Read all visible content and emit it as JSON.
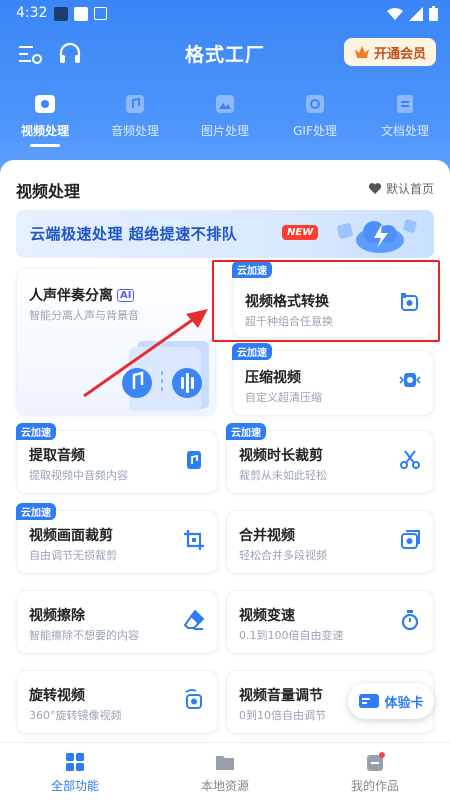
{
  "status": {
    "time": "4:32"
  },
  "header": {
    "title": "格式工厂",
    "vip_label": "开通会员"
  },
  "tabs": [
    {
      "label": "视频处理",
      "icon": "video-icon",
      "active": true
    },
    {
      "label": "音频处理",
      "icon": "audio-icon"
    },
    {
      "label": "图片处理",
      "icon": "image-icon"
    },
    {
      "label": "GIF处理",
      "icon": "gif-icon"
    },
    {
      "label": "文档处理",
      "icon": "document-icon"
    }
  ],
  "section": {
    "title": "视频处理",
    "default_home": "默认首页"
  },
  "banner": {
    "text": "云端极速处理 超绝提速不排队",
    "badge": "NEW"
  },
  "featured": {
    "title": "人声伴奏分离",
    "ai_badge": "AI",
    "subtitle": "智能分离人声与背景音"
  },
  "cloud_badge": "云加速",
  "tools": [
    {
      "title": "视频格式转换",
      "subtitle": "超千种组合任意换",
      "cloud": true
    },
    {
      "title": "压缩视频",
      "subtitle": "自定义超清压缩",
      "cloud": true
    },
    {
      "title": "提取音频",
      "subtitle": "提取视频中音频内容",
      "cloud": true
    },
    {
      "title": "视频时长裁剪",
      "subtitle": "裁剪从未如此轻松",
      "cloud": true
    },
    {
      "title": "视频画面裁剪",
      "subtitle": "自由调节无损裁剪",
      "cloud": true
    },
    {
      "title": "合并视频",
      "subtitle": "轻松合并多段视频",
      "cloud": false
    },
    {
      "title": "视频擦除",
      "subtitle": "智能擦除不想要的内容",
      "cloud": false
    },
    {
      "title": "视频变速",
      "subtitle": "0.1到100倍自由变速",
      "cloud": false
    },
    {
      "title": "旋转视频",
      "subtitle": "360°旋转镜像视频",
      "cloud": false
    },
    {
      "title": "视频音量调节",
      "subtitle": "0到10倍自由调节",
      "cloud": false
    }
  ],
  "trial_card": "体验卡",
  "nav": [
    {
      "label": "全部功能",
      "active": true
    },
    {
      "label": "本地资源"
    },
    {
      "label": "我的作品"
    }
  ],
  "colors": {
    "primary": "#2f7df4",
    "highlight": "#ee2222",
    "vip_bg": "#fff3e3"
  }
}
